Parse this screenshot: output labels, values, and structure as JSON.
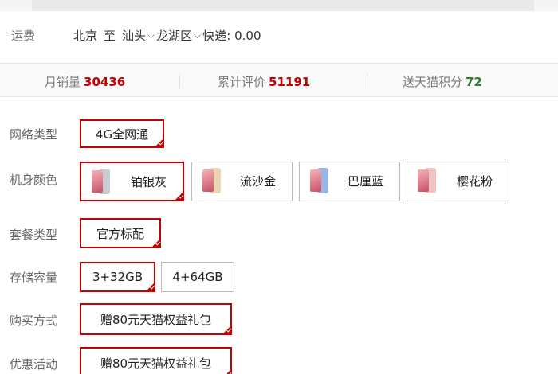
{
  "shipping": {
    "label": "运费",
    "from": "北京",
    "to_word": "至",
    "city": "汕头",
    "district": "龙湖区",
    "fee": "快递: 0.00"
  },
  "stats": {
    "monthly_sales_label": "月销量",
    "monthly_sales_value": "30436",
    "reviews_label": "累计评价",
    "reviews_value": "51191",
    "points_label": "送天猫积分",
    "points_value": "72",
    "colors": {
      "sales": "#c40000",
      "reviews": "#c40000",
      "points": "#2e7d32"
    }
  },
  "options": {
    "network": {
      "label": "网络类型",
      "choices": [
        "4G全网通"
      ],
      "selected": "4G全网通"
    },
    "color": {
      "label": "机身颜色",
      "choices": [
        {
          "name": "铂银灰",
          "swatch": "#c9ccd2"
        },
        {
          "name": "流沙金",
          "swatch": "#ecd5b4"
        },
        {
          "name": "巴厘蓝",
          "swatch": "#9bb4e6"
        },
        {
          "name": "樱花粉",
          "swatch": "#f1c2c2"
        }
      ],
      "selected": "铂银灰"
    },
    "package": {
      "label": "套餐类型",
      "choices": [
        "官方标配"
      ],
      "selected": "官方标配"
    },
    "storage": {
      "label": "存储容量",
      "choices": [
        "3+32GB",
        "4+64GB"
      ],
      "selected": "3+32GB"
    },
    "purchase": {
      "label": "购买方式",
      "choices": [
        "赠80元天猫权益礼包"
      ],
      "selected": "赠80元天猫权益礼包"
    },
    "promo": {
      "label": "优惠活动",
      "choices": [
        "赠80元天猫权益礼包"
      ],
      "selected": "赠80元天猫权益礼包"
    }
  },
  "accent_color": "#c40000"
}
